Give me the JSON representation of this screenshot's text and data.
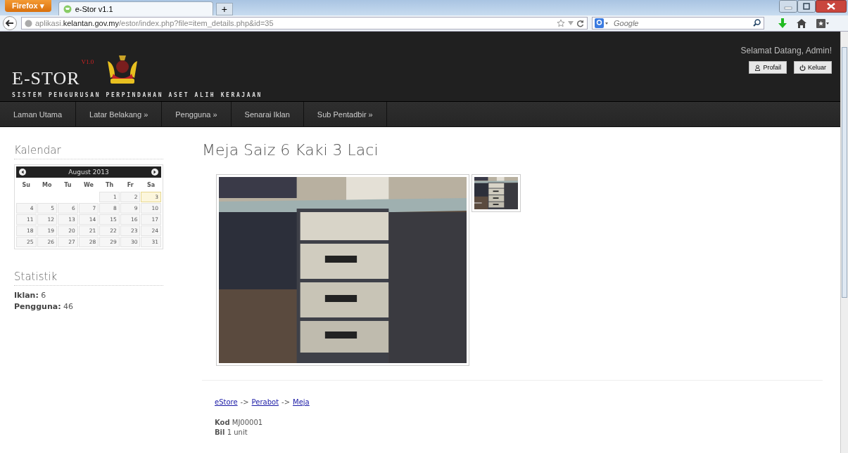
{
  "browser": {
    "menu_button": "Firefox ▾",
    "tabs": [
      {
        "title": "e-Stor v1.1",
        "selected": true
      }
    ],
    "new_tab": "+",
    "address": {
      "prefix": "aplikasi.",
      "domain": "kelantan.gov.my",
      "path": "/estor/index.php?file=item_details.php&id=35"
    },
    "search": {
      "placeholder": "Google"
    }
  },
  "header": {
    "logo": "E-STOR",
    "version": "V1.0",
    "subtitle": "SISTEM PENGURUSAN PERPINDAHAN ASET ALIH KERAJAAN",
    "welcome": "Selamat Datang, Admin!",
    "buttons": [
      {
        "kind": "user",
        "label": "Profail"
      },
      {
        "kind": "power",
        "label": "Keluar"
      }
    ]
  },
  "menu": [
    {
      "label": "Laman Utama"
    },
    {
      "label": "Latar Belakang »"
    },
    {
      "label": "Pengguna »"
    },
    {
      "label": "Senarai Iklan"
    },
    {
      "label": "Sub Pentadbir »"
    }
  ],
  "sidebar": {
    "calendar": {
      "heading": "Kalendar",
      "month": "August 2013",
      "weekdays": [
        "Su",
        "Mo",
        "Tu",
        "We",
        "Th",
        "Fr",
        "Sa"
      ],
      "weeks": [
        [
          {
            "day": "1",
            "selected": false
          },
          {
            "day": "2",
            "selected": false
          },
          {
            "day": "3",
            "selected": true
          }
        ],
        [
          {
            "day": "4",
            "selected": false
          },
          {
            "day": "5",
            "selected": false
          },
          {
            "day": "6",
            "selected": false
          },
          {
            "day": "7",
            "selected": false
          },
          {
            "day": "8",
            "selected": false
          },
          {
            "day": "9",
            "selected": false
          },
          {
            "day": "10",
            "selected": false
          }
        ],
        [
          {
            "day": "11",
            "selected": false
          },
          {
            "day": "12",
            "selected": false
          },
          {
            "day": "13",
            "selected": false
          },
          {
            "day": "14",
            "selected": false
          },
          {
            "day": "15",
            "selected": false
          },
          {
            "day": "16",
            "selected": false
          },
          {
            "day": "17",
            "selected": false
          }
        ],
        [
          {
            "day": "18",
            "selected": false
          },
          {
            "day": "19",
            "selected": false
          },
          {
            "day": "20",
            "selected": false
          },
          {
            "day": "21",
            "selected": false
          },
          {
            "day": "22",
            "selected": false
          },
          {
            "day": "23",
            "selected": false
          },
          {
            "day": "24",
            "selected": false
          }
        ],
        [
          {
            "day": "25",
            "selected": false
          },
          {
            "day": "26",
            "selected": false
          },
          {
            "day": "27",
            "selected": false
          },
          {
            "day": "28",
            "selected": false
          },
          {
            "day": "29",
            "selected": false
          },
          {
            "day": "30",
            "selected": false
          },
          {
            "day": "31",
            "selected": false
          }
        ]
      ]
    },
    "stats": {
      "heading": "Statistik",
      "items": [
        {
          "label": "Iklan:",
          "value": "6"
        },
        {
          "label": "Pengguna:",
          "value": "46"
        }
      ]
    }
  },
  "item": {
    "title": "Meja Saiz 6 Kaki 3 Laci",
    "breadcrumb": [
      {
        "label": "eStore"
      },
      {
        "label": "Perabot"
      },
      {
        "label": "Meja"
      }
    ],
    "separator": "->",
    "details": [
      {
        "label": "Kod",
        "value": "MJ00001"
      },
      {
        "label": "Bil",
        "value": "1 unit"
      }
    ]
  }
}
